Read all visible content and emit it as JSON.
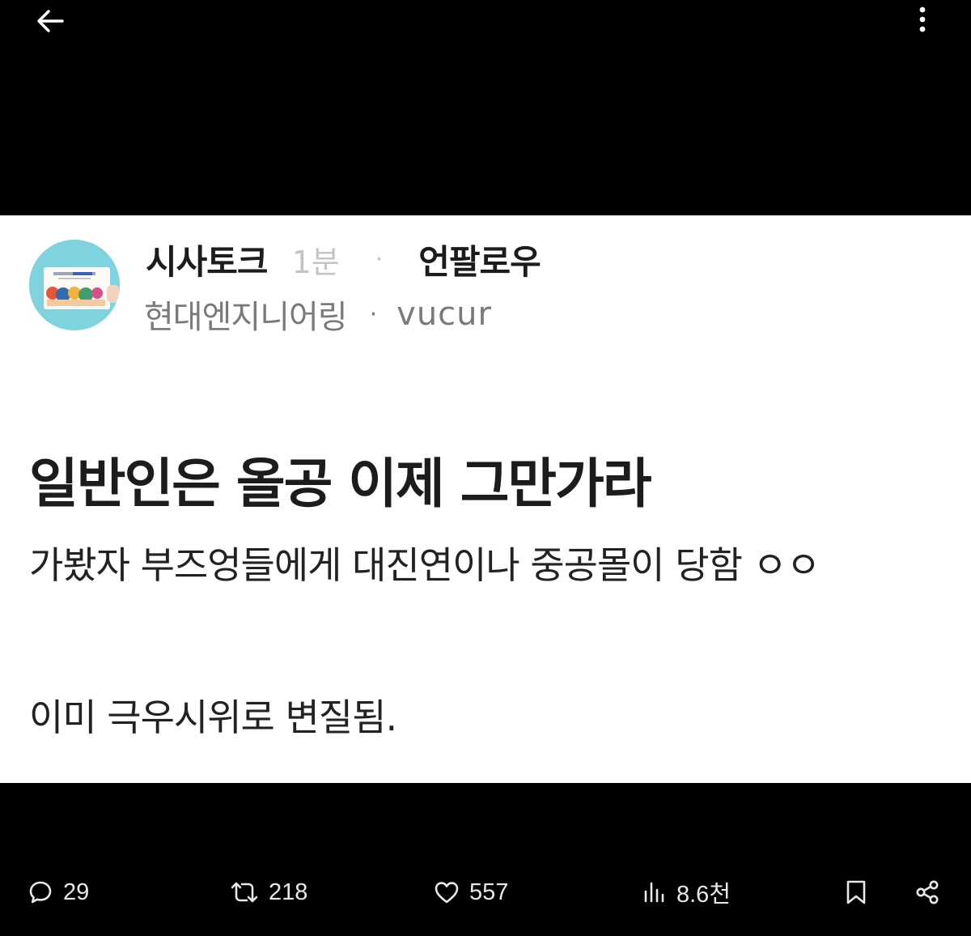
{
  "header": {
    "back_icon": "arrow-left-icon",
    "more_icon": "more-vertical-icon"
  },
  "post": {
    "avatar_icon": "board-avatar",
    "board_name": "시사토크",
    "time_ago": "1분",
    "separator": "·",
    "unfollow_label": "언팔로우",
    "company": "현대엔지니어링",
    "username": "vucur",
    "title": "일반인은 올공 이제 그만가라",
    "body_lines": [
      "가봤자 부즈엉들에게 대진연이나 중공몰이 당함 ㅇㅇ",
      "이미 극우시위로 변질됨."
    ]
  },
  "actions": {
    "reply": {
      "icon": "comment-icon",
      "count": "29"
    },
    "repost": {
      "icon": "repost-icon",
      "count": "218"
    },
    "like": {
      "icon": "heart-icon",
      "count": "557"
    },
    "views": {
      "icon": "bar-chart-icon",
      "count": "8.6천"
    },
    "bookmark": {
      "icon": "bookmark-icon"
    },
    "share": {
      "icon": "share-icon"
    }
  },
  "colors": {
    "background": "#000000",
    "card": "#ffffff",
    "text_primary": "#1c1c1c",
    "text_secondary": "#7a7a7a",
    "text_muted": "#c4c4c4",
    "action_icons": "#e8e8e8",
    "avatar_bg": "#7fd3df"
  }
}
